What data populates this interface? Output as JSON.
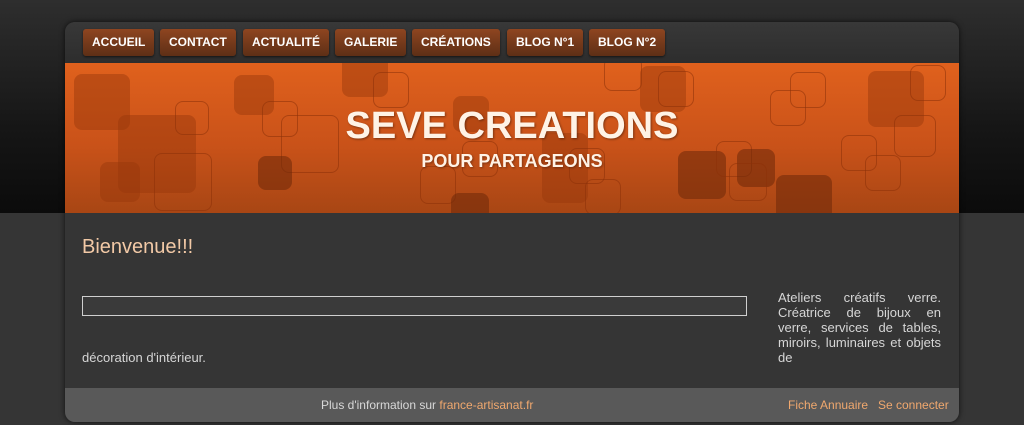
{
  "nav": {
    "items": [
      {
        "label": "ACCUEIL"
      },
      {
        "label": "CONTACT"
      },
      {
        "label": "ACTUALITÉ"
      },
      {
        "label": "GALERIE"
      },
      {
        "label": "CRÉATIONS"
      },
      {
        "label": "BLOG N°1"
      },
      {
        "label": "BLOG N°2"
      }
    ]
  },
  "banner": {
    "title": "SEVE CREATIONS",
    "subtitle": "POUR PARTAGEONS"
  },
  "main": {
    "heading": "Bienvenue!!!",
    "side_text": "Ateliers créatifs verre. Créatrice de bijoux en verre, services de tables, miroirs, luminaires et objets de",
    "continued_text": "décoration d'intérieur."
  },
  "footer": {
    "info_prefix": "Plus d'information sur",
    "info_link": "france-artisanat.fr",
    "annuaire": "Fiche Annuaire",
    "login": "Se connecter"
  },
  "colors": {
    "accent": "#e0611d",
    "link": "#f0a86e",
    "heading": "#f2c9a6"
  }
}
